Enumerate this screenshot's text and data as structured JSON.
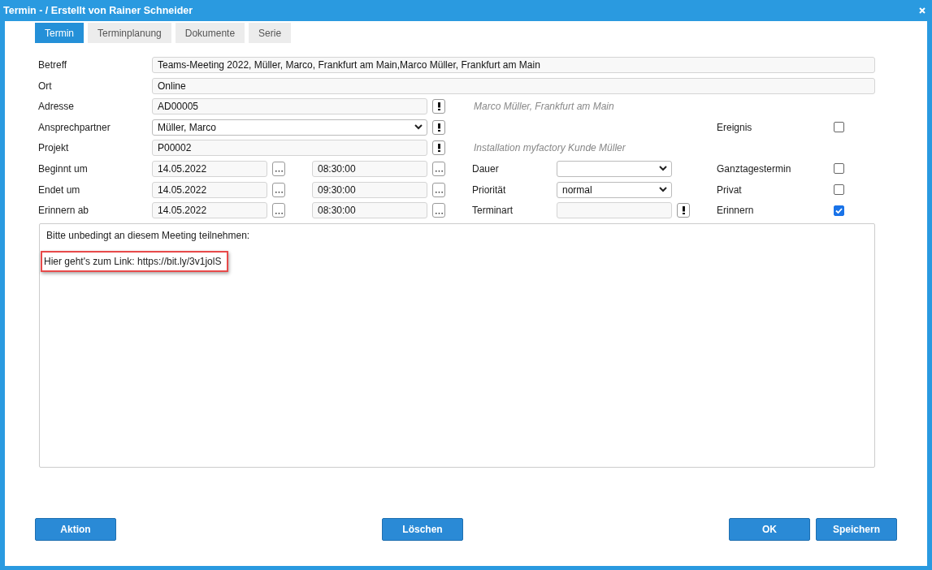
{
  "window": {
    "title": "Termin - / Erstellt von Rainer Schneider"
  },
  "tabs": [
    {
      "label": "Termin",
      "selected": true
    },
    {
      "label": "Terminplanung",
      "selected": false
    },
    {
      "label": "Dokumente",
      "selected": false
    },
    {
      "label": "Serie",
      "selected": false
    }
  ],
  "rows": [
    {
      "kind": "wide",
      "label": "Betreff",
      "value": "Teams-Meeting 2022, Müller, Marco, Frankfurt am Main,Marco Müller, Frankfurt am Main"
    },
    {
      "kind": "wide",
      "label": "Ort",
      "value": "Online"
    },
    {
      "kind": "lookup",
      "label": "Adresse",
      "value": "AD00005",
      "note": "Marco Müller, Frankfurt am Main"
    },
    {
      "kind": "lookup-select",
      "label": "Ansprechpartner",
      "value": "Müller, Marco",
      "flag": {
        "label": "Ereignis",
        "checked": false
      }
    },
    {
      "kind": "lookup",
      "label": "Projekt",
      "value": "P00002",
      "note": "Installation myfactory Kunde Müller"
    },
    {
      "kind": "datetime",
      "label": "Beginnt um",
      "date": "14.05.2022",
      "time": "08:30:00",
      "extra": {
        "kind": "select",
        "label": "Dauer"
      },
      "flag": {
        "label": "Ganztagestermin",
        "checked": false
      }
    },
    {
      "kind": "datetime",
      "label": "Endet um",
      "date": "14.05.2022",
      "time": "09:30:00",
      "extra": {
        "kind": "select",
        "label": "Priorität",
        "value": "normal"
      },
      "flag": {
        "label": "Privat",
        "checked": false
      }
    },
    {
      "kind": "datetime",
      "label": "Erinnern ab",
      "date": "14.05.2022",
      "time": "08:30:00",
      "extra": {
        "kind": "lookup",
        "label": "Terminart"
      },
      "flag": {
        "label": "Erinnern",
        "checked": true
      }
    }
  ],
  "notes": [
    {
      "text": "Bitte unbedingt an diesem Meeting teilnehmen:",
      "highlighted": false
    },
    {
      "text": "Hier geht's zum Link: https://bit.ly/3v1jolS",
      "highlighted": true
    }
  ],
  "buttons": [
    {
      "label": "Aktion",
      "kind": "left"
    },
    {
      "label": "Löschen",
      "kind": "center"
    },
    {
      "label": "OK",
      "kind": "right"
    },
    {
      "label": "Speichern",
      "kind": "right"
    }
  ]
}
